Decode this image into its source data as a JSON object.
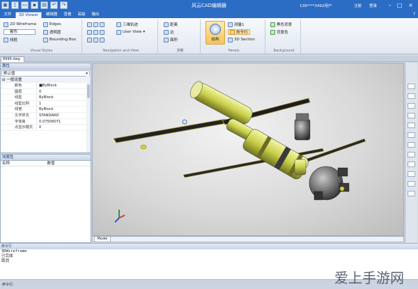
{
  "app": {
    "title": "风云CAD编辑器",
    "user": "139****3492用户",
    "menu_register": "注册",
    "menu_login": "登录",
    "help": "?"
  },
  "tabs": [
    {
      "label": "文件",
      "active": false
    },
    {
      "label": "3D Viewer",
      "active": true
    },
    {
      "label": "编辑器",
      "active": false
    },
    {
      "label": "查看",
      "active": false
    },
    {
      "label": "高级",
      "active": false
    },
    {
      "label": "输出",
      "active": false
    }
  ],
  "ribbon": {
    "visual_styles": {
      "label": "Visual Styles",
      "wireframe": "2D Wireframe",
      "shaded": "着色",
      "edges": "Edges",
      "transparent": "透明度",
      "lines": "线框",
      "bbox": "Bounding Box"
    },
    "navigation": {
      "label": "Navigation and View",
      "orbit": "三维轨迹",
      "user_view": "User View"
    },
    "measure": {
      "label": "测量",
      "distance": "距离",
      "edge": "边",
      "face": "面积"
    },
    "panels": {
      "label": "Panels",
      "model": "结构",
      "measure1": "测量1",
      "command": "命令行",
      "section": "3D Section"
    },
    "background": {
      "label": "Background",
      "bg1": "黑色背景",
      "bg2": "背景色"
    }
  },
  "document": {
    "tab": "8999.dwg",
    "layout_tab": "Model"
  },
  "properties": {
    "header": "属性",
    "selector": "默认值",
    "section": "一般设置",
    "rows": [
      {
        "key": "颜色",
        "value": "■ByBlock"
      },
      {
        "key": "图层",
        "value": "0"
      },
      {
        "key": "线型",
        "value": "ByBlock"
      },
      {
        "key": "线型比例",
        "value": "1"
      },
      {
        "key": "线宽",
        "value": "ByBlock"
      },
      {
        "key": "文字样式",
        "value": "STANDARD"
      },
      {
        "key": "字体高",
        "value": "0.07509071"
      },
      {
        "key": "点显示模式",
        "value": "0"
      }
    ]
  },
  "attributes": {
    "header": "块属性",
    "col_name": "名称",
    "col_value": "数值"
  },
  "command": {
    "header": "命令行",
    "lines": [
      "3DWireframe",
      "已完成",
      "取消"
    ],
    "prompt": "命令行:"
  },
  "watermark": "爱上手游网"
}
